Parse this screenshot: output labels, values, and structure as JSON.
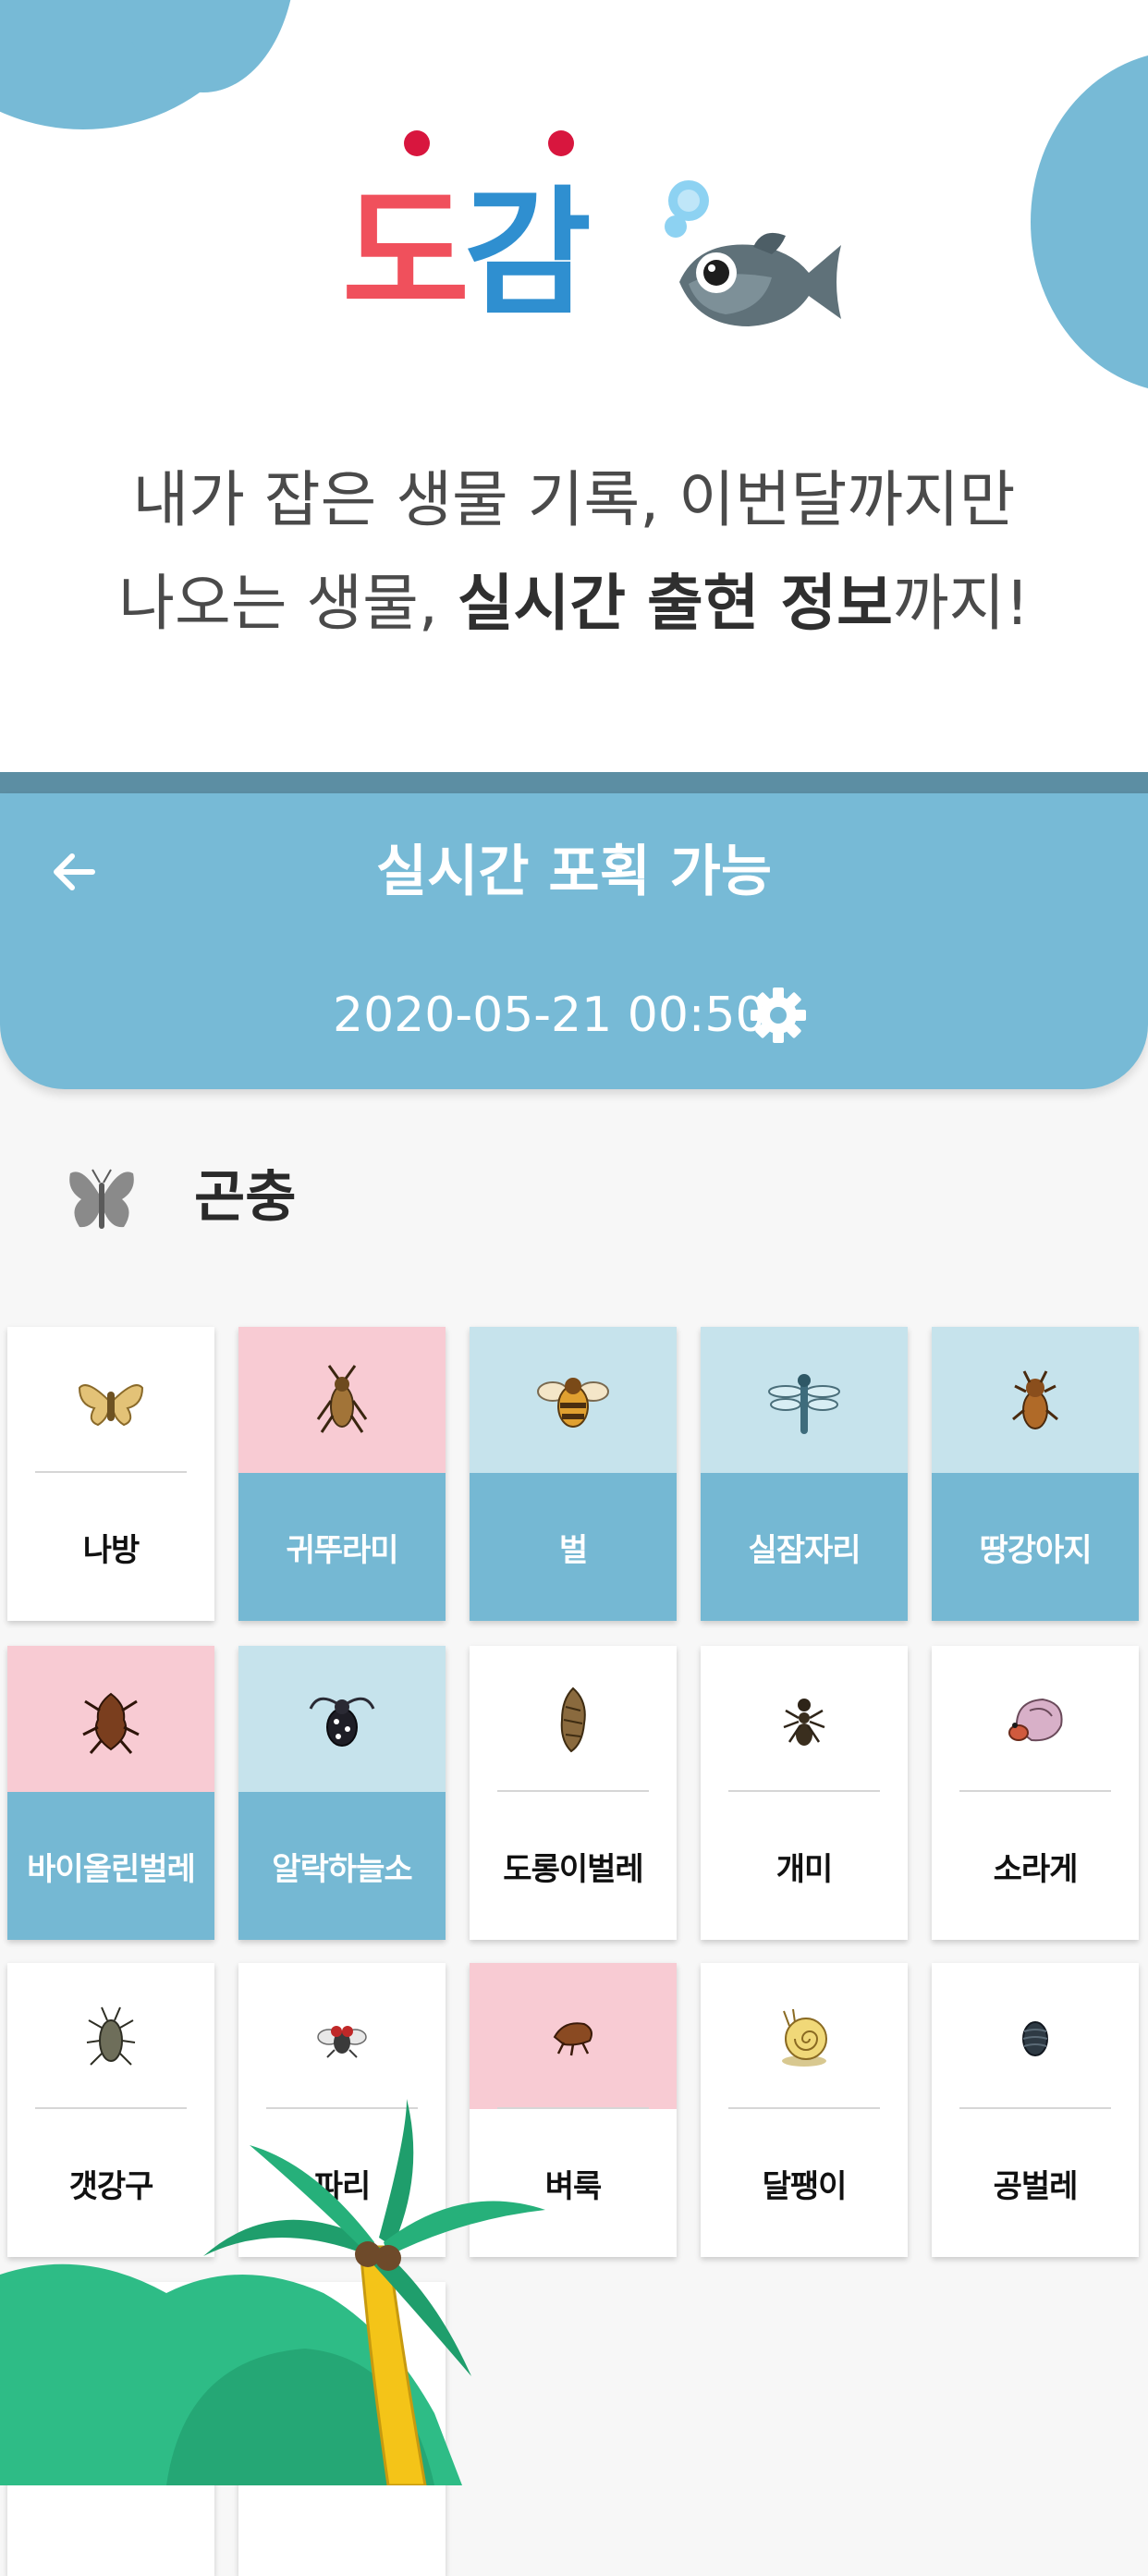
{
  "promo": {
    "logo_part1": "도",
    "logo_part2": "감",
    "tagline_line1": "내가 잡은 생물 기록, 이번달까지만",
    "tagline_line2_a": "나오는 생물, ",
    "tagline_line2_b": "실시간 출현 정보",
    "tagline_line2_c": "까지!"
  },
  "header": {
    "title": "실시간 포획 가능",
    "datetime": "2020-05-21 00:50"
  },
  "section": {
    "title": "곤충"
  },
  "colors": {
    "header": "#77bad6",
    "pink": "#f8cbd3",
    "light_blue": "#c6e3ec",
    "label_blue": "#75b8d3",
    "logo_red": "#f0505c",
    "logo_blue": "#2f8fd0"
  },
  "cards": [
    {
      "label": "나방",
      "style": "plain",
      "icon": "moth-icon"
    },
    {
      "label": "귀뚜라미",
      "style": "pink-blue",
      "icon": "cricket-icon"
    },
    {
      "label": "벌",
      "style": "light-blue",
      "icon": "bee-icon"
    },
    {
      "label": "실잠자리",
      "style": "light-blue",
      "icon": "dragonfly-icon"
    },
    {
      "label": "땅강아지",
      "style": "light-blue",
      "icon": "mole-cricket-icon"
    },
    {
      "label": "바이올린벌레",
      "style": "pink-blue",
      "icon": "violin-beetle-icon"
    },
    {
      "label": "알락하늘소",
      "style": "light-blue",
      "icon": "longhorn-beetle-icon"
    },
    {
      "label": "도롱이벌레",
      "style": "plain",
      "icon": "bagworm-icon"
    },
    {
      "label": "개미",
      "style": "plain",
      "icon": "ant-icon"
    },
    {
      "label": "소라게",
      "style": "plain",
      "icon": "hermit-crab-icon"
    },
    {
      "label": "갯강구",
      "style": "plain",
      "icon": "wharf-roach-icon"
    },
    {
      "label": "파리",
      "style": "plain",
      "icon": "fly-icon"
    },
    {
      "label": "벼룩",
      "style": "pink-plain",
      "icon": "flea-icon"
    },
    {
      "label": "달팽이",
      "style": "plain",
      "icon": "snail-icon"
    },
    {
      "label": "공벌레",
      "style": "plain",
      "icon": "pill-bug-icon"
    },
    {
      "label": "",
      "style": "plain",
      "icon": "partial-card"
    },
    {
      "label": "",
      "style": "plain",
      "icon": "partial-card"
    }
  ]
}
